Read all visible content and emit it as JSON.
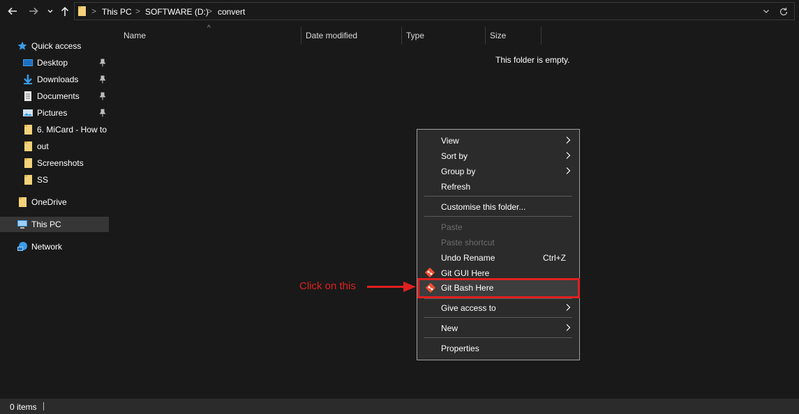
{
  "window": {
    "breadcrumb": [
      "This PC",
      "SOFTWARE (D:)",
      "convert"
    ],
    "separator": ">"
  },
  "navbar": {
    "back_icon": "arrow-left-icon",
    "forward_icon": "arrow-right-icon",
    "recent_icon": "chevron-down-icon",
    "up_icon": "arrow-up-icon",
    "refresh_icon": "refresh-icon"
  },
  "sidebar": {
    "items": [
      {
        "label": "Quick access",
        "icon": "star-icon"
      },
      {
        "label": "Desktop",
        "icon": "desktop-icon",
        "pinned": true
      },
      {
        "label": "Downloads",
        "icon": "download-icon",
        "pinned": true
      },
      {
        "label": "Documents",
        "icon": "documents-icon",
        "pinned": true
      },
      {
        "label": "Pictures",
        "icon": "pictures-icon",
        "pinned": true
      },
      {
        "label": "6. MiCard - How to",
        "icon": "folder-icon"
      },
      {
        "label": "out",
        "icon": "folder-icon"
      },
      {
        "label": "Screenshots",
        "icon": "folder-icon"
      },
      {
        "label": "SS",
        "icon": "folder-icon"
      },
      {
        "label": "OneDrive",
        "icon": "folder-icon"
      },
      {
        "label": "This PC",
        "icon": "computer-icon",
        "selected": true
      },
      {
        "label": "Network",
        "icon": "network-icon"
      }
    ]
  },
  "columns": [
    {
      "label": "Name"
    },
    {
      "label": "Date modified"
    },
    {
      "label": "Type"
    },
    {
      "label": "Size"
    }
  ],
  "empty_message": "This folder is empty.",
  "context_menu": {
    "items": [
      {
        "label": "View",
        "submenu": true
      },
      {
        "label": "Sort by",
        "submenu": true
      },
      {
        "label": "Group by",
        "submenu": true
      },
      {
        "label": "Refresh"
      },
      {
        "label": "Customise this folder..."
      },
      {
        "label": "Paste",
        "disabled": true
      },
      {
        "label": "Paste shortcut",
        "disabled": true
      },
      {
        "label": "Undo Rename",
        "shortcut": "Ctrl+Z"
      },
      {
        "label": "Git GUI Here",
        "icon": "git-icon"
      },
      {
        "label": "Git Bash Here",
        "icon": "git-icon",
        "highlighted": true
      },
      {
        "label": "Give access to",
        "submenu": true
      },
      {
        "label": "New",
        "submenu": true
      },
      {
        "label": "Properties"
      }
    ]
  },
  "annotation": {
    "text": "Click on this",
    "color": "#e02020"
  },
  "status": {
    "item_count": "0 items"
  },
  "colors": {
    "background": "#191919",
    "menu_bg": "#2b2b2b",
    "selected": "#363636",
    "highlight_border": "#e02020"
  }
}
